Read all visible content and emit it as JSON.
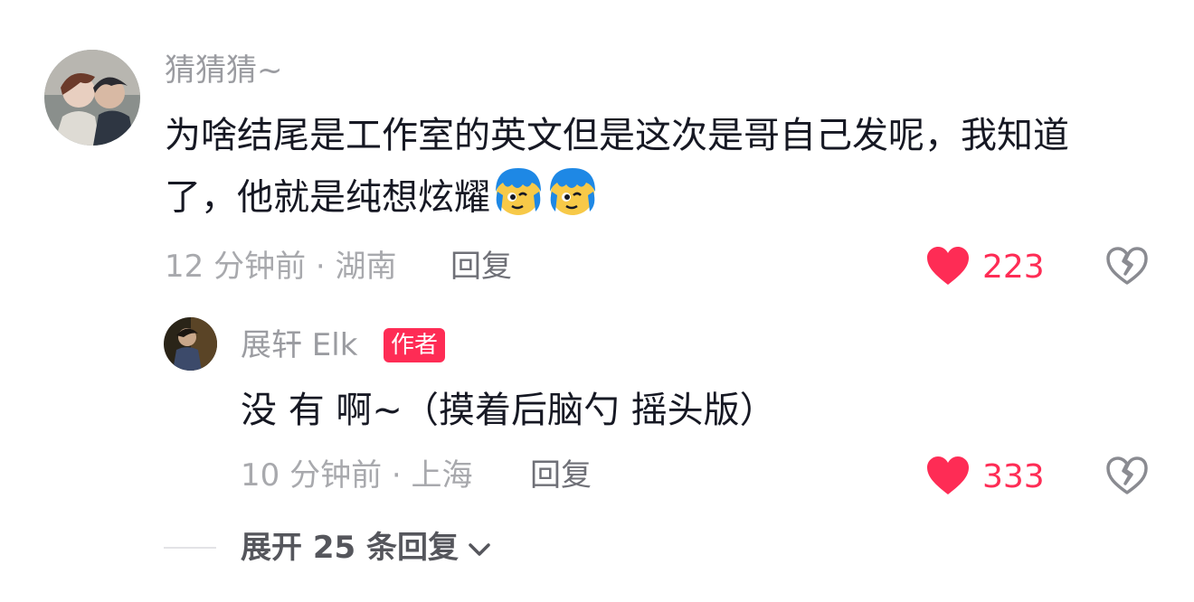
{
  "comment": {
    "username": "猜猜猜~",
    "text": "为啥结尾是工作室的英文但是这次是哥自己发呢，我知道了，他就是纯想炫耀",
    "time_location": "12 分钟前 · 湖南",
    "reply_label": "回复",
    "like_count": "223",
    "emojis": [
      "blue-hair-face-emoji",
      "blue-hair-face-emoji"
    ]
  },
  "reply": {
    "username": "展轩 Elk",
    "badge": "作者",
    "text": "没 有 啊~（摸着后脑勺 摇头版）",
    "time_location": "10 分钟前 · 上海",
    "reply_label": "回复",
    "like_count": "333"
  },
  "expand": {
    "label": "展开 25 条回复"
  },
  "colors": {
    "accent": "#fe2c55",
    "muted_text": "#a8a9ad",
    "body_text": "#161823"
  }
}
